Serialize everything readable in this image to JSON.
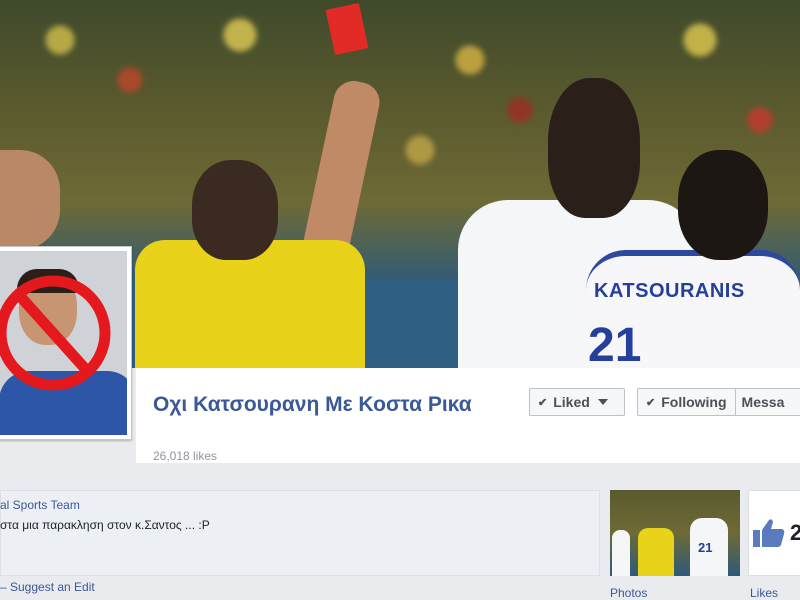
{
  "page": {
    "title": "Οχι Κατσουρανη Με Κοστα Ρικα",
    "likes_count": "26,018 likes"
  },
  "actions": {
    "liked_label": "Liked",
    "following_label": "Following",
    "message_label": "Messa"
  },
  "cover": {
    "jersey_name": "KATSOURANIS",
    "jersey_number": "21"
  },
  "about": {
    "team_link": "al Sports Team",
    "text": "στα μια παρακληση στον κ.Σαντος ... :P",
    "suggest_link": "– Suggest an Edit"
  },
  "photos": {
    "label": "Photos",
    "thumb_number": "21"
  },
  "likes_box": {
    "count": "2",
    "label": "Likes"
  },
  "icons": {
    "check": "check-icon",
    "caret": "caret-down-icon",
    "no_sign": "prohibited-icon",
    "thumb": "thumbs-up-icon"
  },
  "colors": {
    "link": "#3b5998",
    "no_sign_red": "#e3191e",
    "red_card": "#e22a26",
    "referee_yellow": "#e8d21a",
    "greece_blue": "#25409a"
  }
}
